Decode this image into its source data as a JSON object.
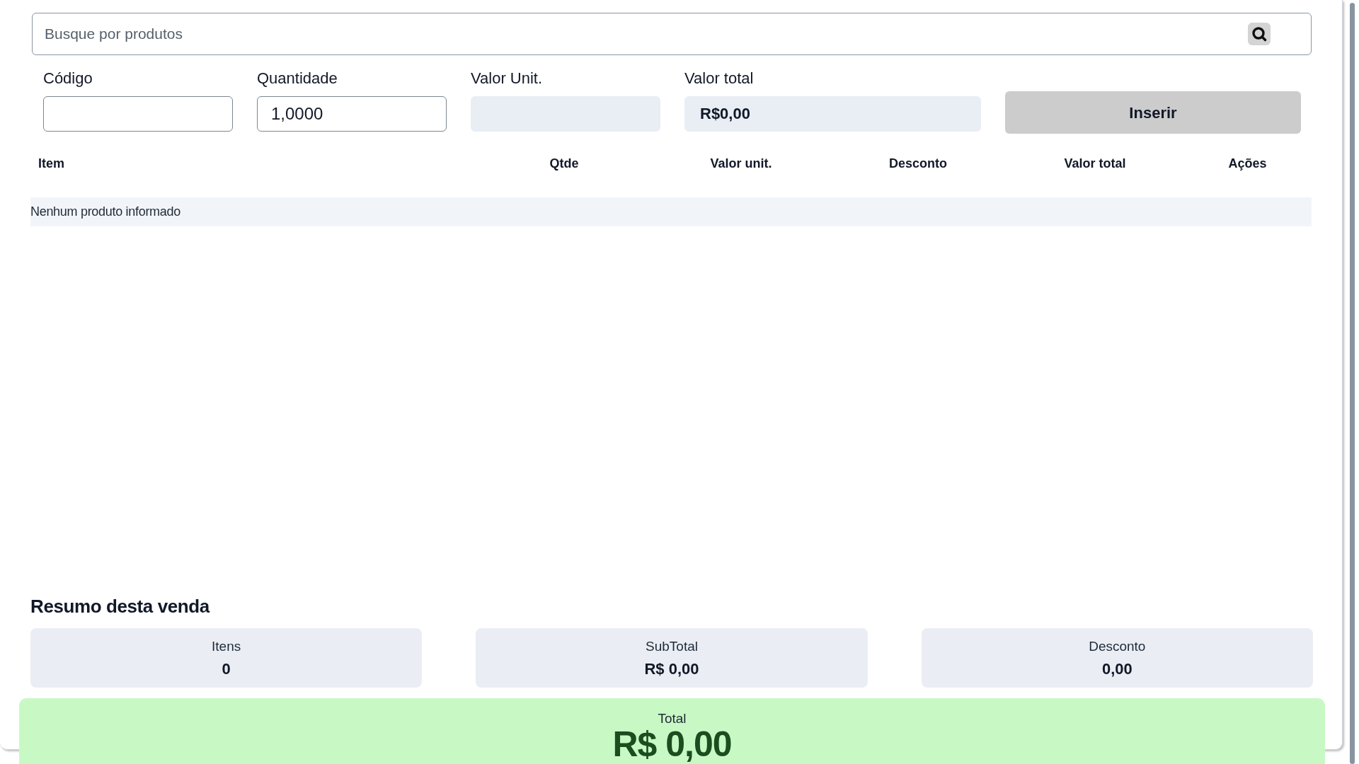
{
  "search": {
    "placeholder": "Busque por produtos"
  },
  "fields": [
    {
      "label": "Código",
      "disabled": false
    },
    {
      "label": "Quantidade",
      "value": "1,0000",
      "disabled": false
    },
    {
      "label": "Valor Unit.",
      "disabled": true
    },
    {
      "label": "Valor total",
      "value": "R$0,00",
      "disabled": true
    }
  ],
  "insert_button": {
    "label": "Inserir"
  },
  "table": {
    "columns": [
      "Item",
      "Qtde",
      "Valor unit.",
      "Desconto",
      "Valor total",
      "Ações"
    ],
    "empty_message": "Nenhum produto informado"
  },
  "summary": {
    "title": "Resumo desta venda",
    "cards": [
      {
        "label": "Itens",
        "value": "0"
      },
      {
        "label": "SubTotal",
        "value": "R$ 0,00"
      },
      {
        "label": "Desconto",
        "value": "0,00"
      }
    ]
  },
  "total": {
    "label": "Total",
    "value": "R$ 0,00"
  }
}
